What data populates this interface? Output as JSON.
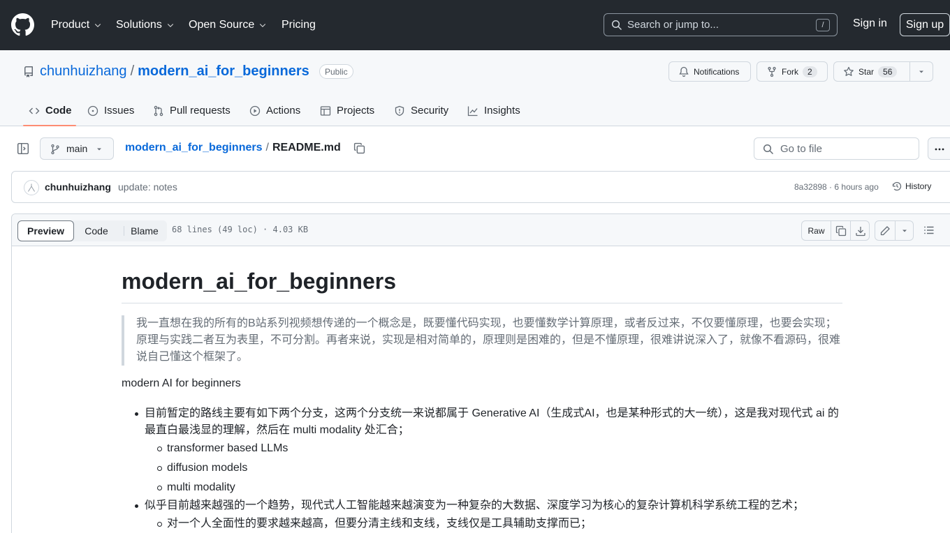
{
  "header": {
    "nav": [
      {
        "label": "Product",
        "has_dropdown": true
      },
      {
        "label": "Solutions",
        "has_dropdown": true
      },
      {
        "label": "Open Source",
        "has_dropdown": true
      },
      {
        "label": "Pricing",
        "has_dropdown": false
      }
    ],
    "search_placeholder": "Search or jump to...",
    "search_shortcut": "/",
    "signin_label": "Sign in",
    "signup_label": "Sign up"
  },
  "repo": {
    "owner": "chunhuizhang",
    "separator": "/",
    "name": "modern_ai_for_beginners",
    "visibility": "Public",
    "notifications_label": "Notifications",
    "fork_label": "Fork",
    "fork_count": "2",
    "star_label": "Star",
    "star_count": "56",
    "tabs": [
      {
        "label": "Code",
        "icon": "code-icon",
        "active": true
      },
      {
        "label": "Issues",
        "icon": "issue-icon",
        "active": false
      },
      {
        "label": "Pull requests",
        "icon": "pull-request-icon",
        "active": false
      },
      {
        "label": "Actions",
        "icon": "play-icon",
        "active": false
      },
      {
        "label": "Projects",
        "icon": "table-icon",
        "active": false
      },
      {
        "label": "Security",
        "icon": "shield-icon",
        "active": false
      },
      {
        "label": "Insights",
        "icon": "graph-icon",
        "active": false
      }
    ]
  },
  "file_nav": {
    "branch": "main",
    "breadcrumb_repo": "modern_ai_for_beginners",
    "breadcrumb_sep": "/",
    "file_name": "README.md",
    "goto_placeholder": "Go to file"
  },
  "commit": {
    "author": "chunhuizhang",
    "message": "update: notes",
    "sha_time": "8a32898 · 6 hours ago",
    "history_label": "History"
  },
  "file_header": {
    "views": [
      "Preview",
      "Code",
      "Blame"
    ],
    "active_view": "Preview",
    "info": "68 lines (49 loc) · 4.03 KB",
    "raw_label": "Raw"
  },
  "readme": {
    "title": "modern_ai_for_beginners",
    "quote": "我一直想在我的所有的B站系列视频想传递的一个概念是，既要懂代码实现，也要懂数学计算原理，或者反过来，不仅要懂原理，也要会实现；  原理与实践二者互为表里，不可分割。再者来说，实现是相对简单的，原理则是困难的，但是不懂原理，很难讲说深入了，就像不看源码，很难说自己懂这个框架了。",
    "intro": "modern AI for beginners",
    "list": [
      {
        "text": "目前暂定的路线主要有如下两个分支，这两个分支统一来说都属于 Generative AI（生成式AI，也是某种形式的大一统），这是我对现代式 ai 的最直白最浅显的理解，然后在 multi modality 处汇合；",
        "children": [
          "transformer based LLMs",
          "diffusion models",
          "multi modality"
        ]
      },
      {
        "text": "似乎目前越来越强的一个趋势，现代式人工智能越来越演变为一种复杂的大数据、深度学习为核心的复杂计算机科学系统工程的艺术；",
        "children": [
          "对一个人全面性的要求越来越高，但要分清主线和支线，支线仅是工具辅助支撑而已；"
        ]
      }
    ]
  },
  "colors": {
    "header_bg": "#24292f",
    "link": "#0969da",
    "tab_underline": "#fd8c73",
    "muted": "#656d76",
    "border": "#d0d7de"
  }
}
